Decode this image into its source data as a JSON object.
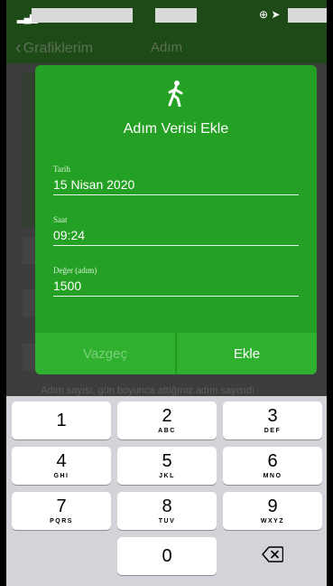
{
  "nav": {
    "back_label": "Grafiklerim",
    "title": "Adım"
  },
  "background": {
    "hint": "Adım sayısı, gün boyunca attığınız adım sayısıdı"
  },
  "dialog": {
    "icon": "walking-person-icon",
    "title": "Adım Verisi Ekle",
    "fields": [
      {
        "label": "Tarih",
        "value": "15 Nisan 2020"
      },
      {
        "label": "Saat",
        "value": "09:24"
      },
      {
        "label": "Değer (adım)",
        "value": "1500"
      }
    ],
    "cancel_label": "Vazgeç",
    "add_label": "Ekle"
  },
  "keypad": {
    "keys": [
      {
        "digit": "1",
        "letters": ""
      },
      {
        "digit": "2",
        "letters": "ABC"
      },
      {
        "digit": "3",
        "letters": "DEF"
      },
      {
        "digit": "4",
        "letters": "GHI"
      },
      {
        "digit": "5",
        "letters": "JKL"
      },
      {
        "digit": "6",
        "letters": "MNO"
      },
      {
        "digit": "7",
        "letters": "PQRS"
      },
      {
        "digit": "8",
        "letters": "TUV"
      },
      {
        "digit": "9",
        "letters": "WXYZ"
      },
      {
        "digit": "0",
        "letters": ""
      }
    ],
    "delete_icon": "backspace-icon"
  }
}
